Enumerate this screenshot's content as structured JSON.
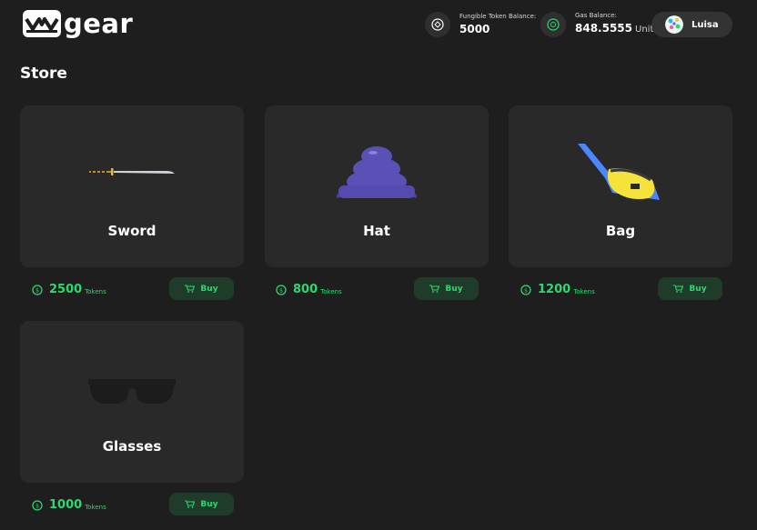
{
  "header": {
    "logo_text": "gear",
    "fungible_label": "Fungible Token Balance:",
    "fungible_value": "5000",
    "gas_label": "Gas Balance:",
    "gas_value": "848.5555",
    "gas_unit": "Unit",
    "user_name": "Luisa",
    "brand_color": "#ffffff",
    "accent_color": "#2bd96e"
  },
  "store": {
    "title": "Store",
    "items": [
      {
        "name": "Sword",
        "price": "2500",
        "unit": "Tokens",
        "buy_label": "Buy"
      },
      {
        "name": "Hat",
        "price": "800",
        "unit": "Tokens",
        "buy_label": "Buy"
      },
      {
        "name": "Bag",
        "price": "1200",
        "unit": "Tokens",
        "buy_label": "Buy"
      },
      {
        "name": "Glasses",
        "price": "1000",
        "unit": "Tokens",
        "buy_label": "Buy"
      }
    ]
  }
}
